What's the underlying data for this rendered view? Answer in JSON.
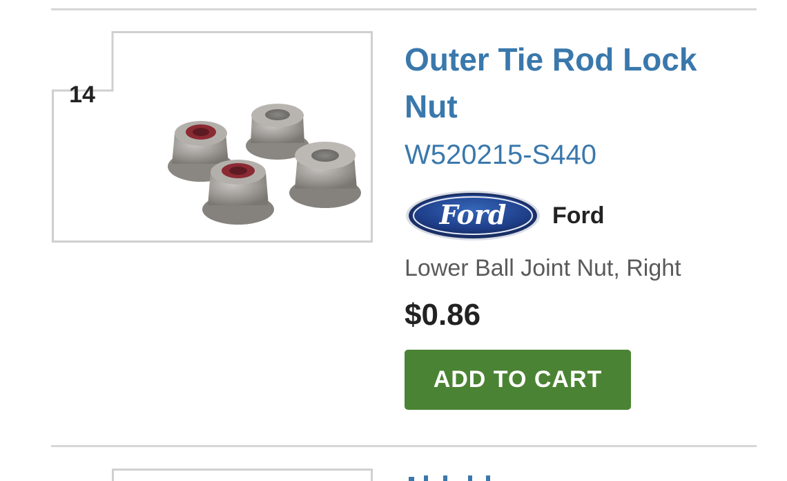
{
  "item": {
    "index": "14",
    "title": "Outer Tie Rod Lock Nut",
    "part_number": "W520215-S440",
    "brand": {
      "name": "Ford",
      "logo_text": "Ford",
      "logo_icon": "ford-oval-logo"
    },
    "description": "Lower Ball Joint Nut, Right",
    "price": "$0.86",
    "add_to_cart_label": "ADD TO CART",
    "image_icon": "lock-nuts-photo"
  },
  "colors": {
    "link_blue": "#3a78ac",
    "button_green": "#4b8334",
    "divider": "#d6d6d6",
    "text_dark": "#222222",
    "text_muted": "#5a5a5a",
    "ford_blue": "#1f3f8a"
  }
}
